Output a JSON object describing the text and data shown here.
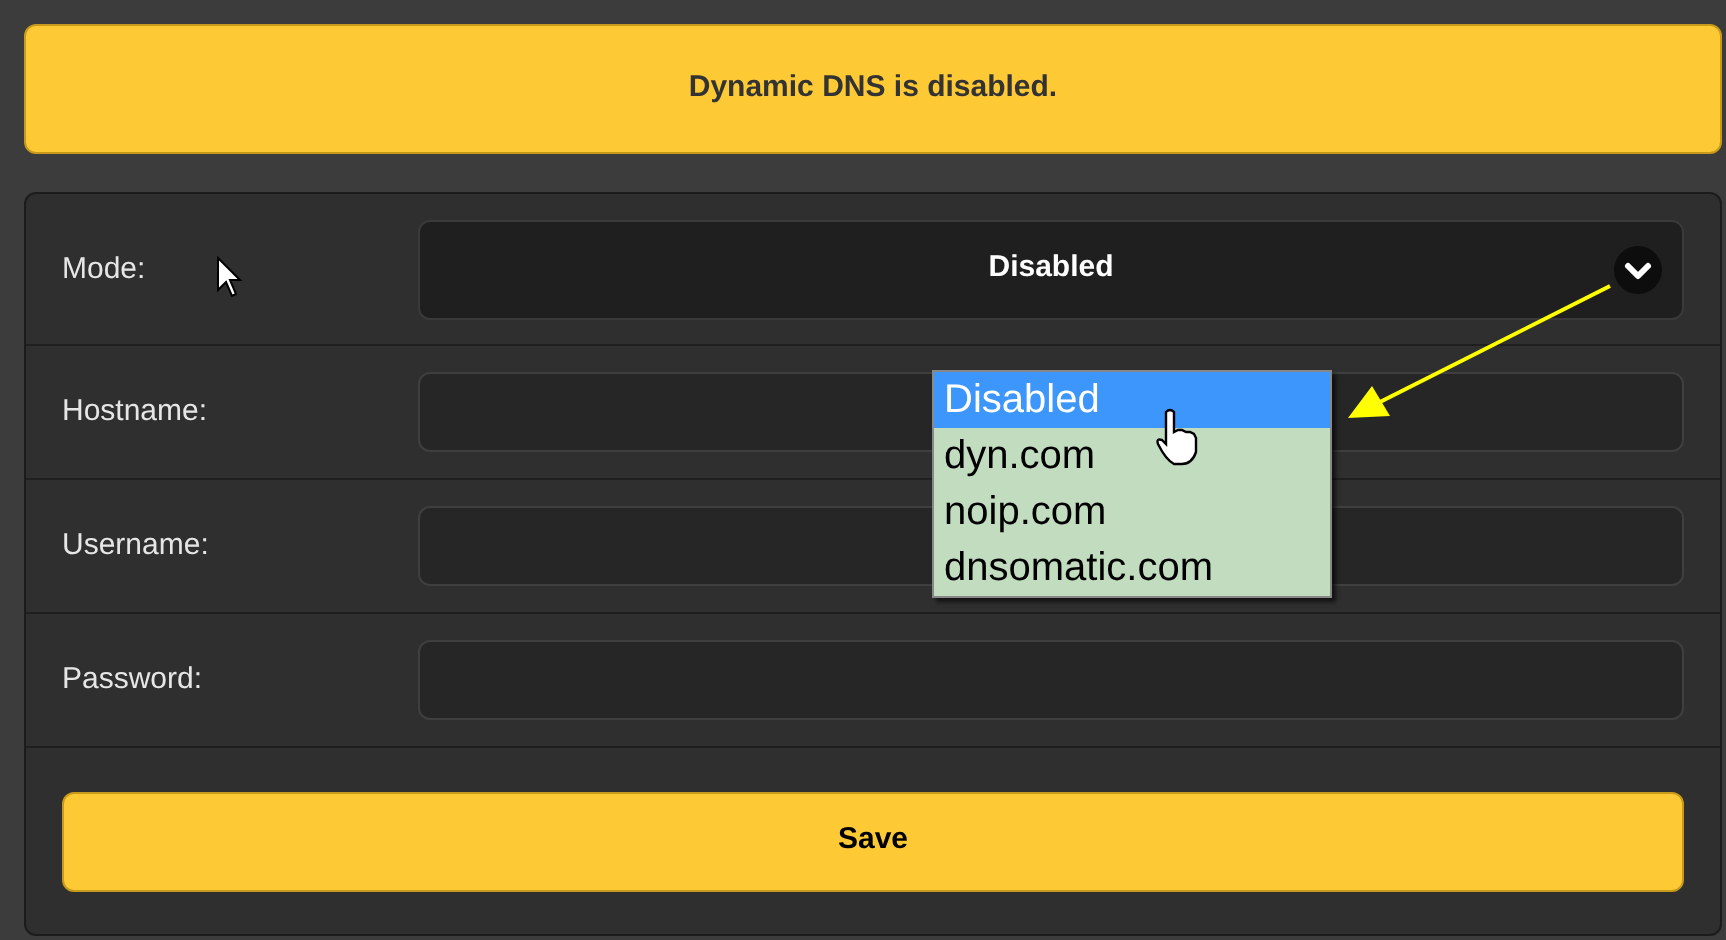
{
  "banner": {
    "text": "Dynamic DNS is disabled."
  },
  "fields": [
    {
      "label": "Mode:",
      "kind": "select",
      "value": "Disabled",
      "expanded": true,
      "options": [
        {
          "label": "Disabled",
          "selected": true
        },
        {
          "label": "dyn.com",
          "selected": false
        },
        {
          "label": "noip.com",
          "selected": false
        },
        {
          "label": "dnsomatic.com",
          "selected": false
        }
      ]
    },
    {
      "label": "Hostname:",
      "kind": "text"
    },
    {
      "label": "Username:",
      "kind": "text"
    },
    {
      "label": "Password:",
      "kind": "password"
    }
  ],
  "save_button": {
    "label": "Save"
  }
}
